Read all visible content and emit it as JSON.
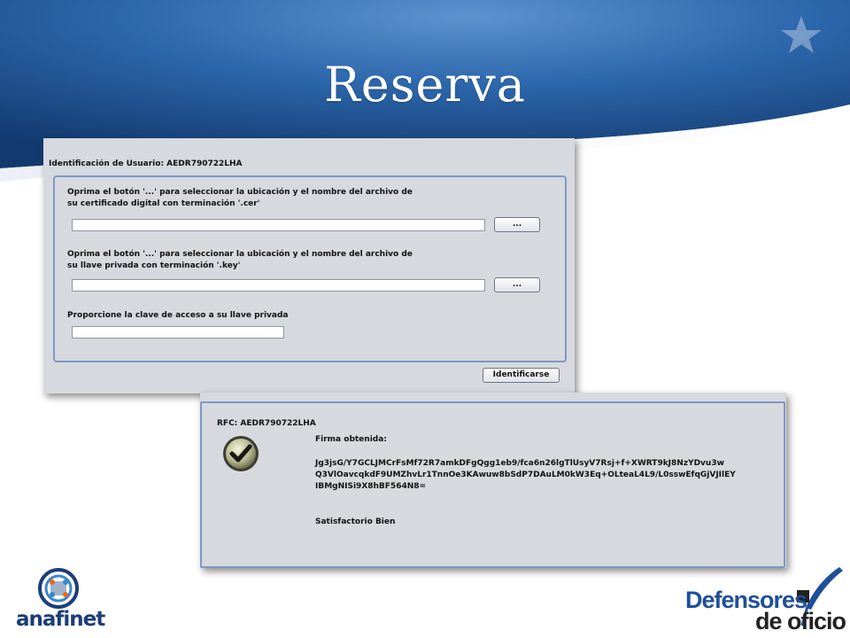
{
  "slide": {
    "title": "Reserva"
  },
  "identificacion": {
    "user_label": "Identificación de Usuario: AEDR790722LHA",
    "cer_instructions_line1": "Oprima el  botón '...' para seleccionar la ubicación y el nombre del archivo de",
    "cer_instructions_line2": "su certificado digital con terminación '.cer'",
    "cer_field_value": "",
    "cer_browse_label": "...",
    "key_instructions_line1": "Oprima el  botón '...' para seleccionar la ubicación y el nombre del archivo de",
    "key_instructions_line2": "su llave privada con terminación '.key'",
    "key_field_value": "",
    "key_browse_label": "...",
    "password_label": "Proporcione la clave de acceso a su llave privada",
    "password_value": "",
    "submit_label": "Identificarse"
  },
  "resultado": {
    "rfc_label": "RFC: AEDR790722LHA",
    "firma_label": "Firma obtenida:",
    "firma_line1": "Jg3jsG/Y7GCLJMCrFsMf72R7amkDFgQgg1eb9/fca6n26lgTlUsyV7Rsj+f+XWRT9kJ8NzYDvu3w",
    "firma_line2": "Q3VlOavcqkdF9UMZhvLr1TnnOe3KAwuw8bSdP7DAuLM0kW3Eq+OLteaL4L9/L0sswEfqGjVJIlEY",
    "firma_line3": "IBMgNISi9X8hBF564N8=",
    "status": "Satisfactorio Bien"
  },
  "logos": {
    "anafinet": "anafinet",
    "defensores_line1": "Defensores",
    "defensores_line2": "de oficio"
  },
  "icons": {
    "success": "check-circle-icon"
  },
  "colors": {
    "title_bg": "#1f5a9e",
    "panel_bg": "#d6d9de",
    "panel_border": "#7f97c4",
    "anafinet_blue": "#1b3d7a",
    "defensores_blue": "#1f4f9a"
  }
}
